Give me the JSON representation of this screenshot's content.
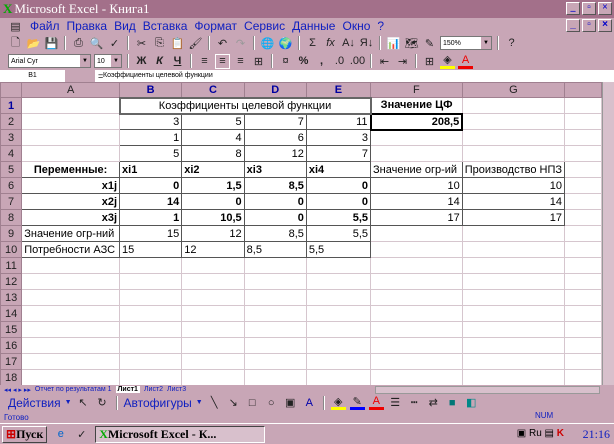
{
  "window": {
    "title": "Microsoft Excel - Книга1"
  },
  "menu": [
    "Файл",
    "Правка",
    "Вид",
    "Вставка",
    "Формат",
    "Сервис",
    "Данные",
    "Окно",
    "?"
  ],
  "toolbar": {
    "zoom": "150%",
    "font": "Arial Cyr",
    "size": "10",
    "bold": "Ж",
    "italic": "К",
    "underline": "Ч",
    "percent": "%",
    "comma": ",",
    "sum": "Σ",
    "fx": "fx"
  },
  "formula_bar": {
    "cell": "B1",
    "eq": "=",
    "content": "Коэффициенты целевой функции"
  },
  "columns": [
    "A",
    "B",
    "C",
    "D",
    "E",
    "F",
    "G",
    ""
  ],
  "rows": [
    [
      "",
      "Коэффициенты целевой функции",
      "",
      "",
      "",
      "Значение ЦФ",
      ""
    ],
    [
      "",
      "3",
      "5",
      "7",
      "11",
      "208,5",
      ""
    ],
    [
      "",
      "1",
      "4",
      "6",
      "3",
      "",
      ""
    ],
    [
      "",
      "5",
      "8",
      "12",
      "7",
      "",
      ""
    ],
    [
      "Переменные:",
      "xi1",
      "xi2",
      "xi3",
      "xi4",
      "Значение огр-ий",
      "Производство НПЗ"
    ],
    [
      "x1j",
      "0",
      "1,5",
      "8,5",
      "0",
      "10",
      "10"
    ],
    [
      "x2j",
      "14",
      "0",
      "0",
      "0",
      "14",
      "14"
    ],
    [
      "x3j",
      "1",
      "10,5",
      "0",
      "5,5",
      "17",
      "17"
    ],
    [
      "Значение огр-ний",
      "15",
      "12",
      "8,5",
      "5,5",
      "",
      ""
    ],
    [
      "Потребности АЗС",
      "15",
      "12",
      "8,5",
      "5,5",
      "",
      ""
    ],
    [
      "",
      "",
      "",
      "",
      "",
      "",
      ""
    ],
    [
      "",
      "",
      "",
      "",
      "",
      "",
      ""
    ],
    [
      "",
      "",
      "",
      "",
      "",
      "",
      ""
    ],
    [
      "",
      "",
      "",
      "",
      "",
      "",
      ""
    ],
    [
      "",
      "",
      "",
      "",
      "",
      "",
      ""
    ],
    [
      "",
      "",
      "",
      "",
      "",
      "",
      ""
    ],
    [
      "",
      "",
      "",
      "",
      "",
      "",
      ""
    ],
    [
      "",
      "",
      "",
      "",
      "",
      "",
      ""
    ]
  ],
  "sheet_tabs": [
    "Отчет по результатам 1",
    "Лист1",
    "Лист2",
    "Лист3"
  ],
  "drawing": {
    "actions": "Действия",
    "autoshapes": "Автофигуры"
  },
  "status": {
    "text": "Готово",
    "num": "NUM"
  },
  "taskbar": {
    "start": "Пуск",
    "task": "Microsoft Excel - К...",
    "clock": "21:16"
  }
}
